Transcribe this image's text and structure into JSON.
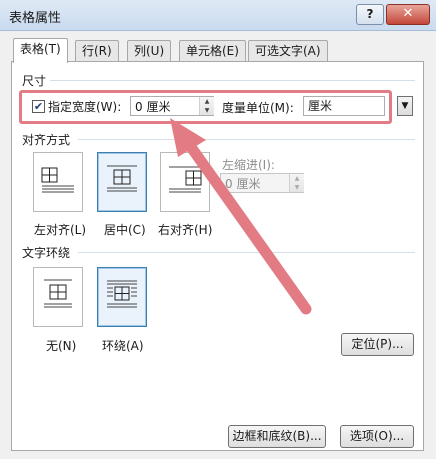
{
  "window": {
    "title": "表格属性",
    "help_label": "?",
    "close_label": "✕"
  },
  "tabs": [
    {
      "label": "表格(T)"
    },
    {
      "label": "行(R)"
    },
    {
      "label": "列(U)"
    },
    {
      "label": "单元格(E)"
    },
    {
      "label": "可选文字(A)"
    }
  ],
  "size": {
    "group_label": "尺寸",
    "checkbox_checked": true,
    "checkbox_label": "指定宽度(W):",
    "width_value": "0 厘米",
    "unit_label": "度量单位(M):",
    "unit_value": "厘米"
  },
  "alignment": {
    "group_label": "对齐方式",
    "options": [
      {
        "label": "左对齐(L)",
        "selected": false
      },
      {
        "label": "居中(C)",
        "selected": true
      },
      {
        "label": "右对齐(H)",
        "selected": false
      }
    ],
    "indent_label": "左缩进(I):",
    "indent_value": "0 厘米"
  },
  "wrapping": {
    "group_label": "文字环绕",
    "options": [
      {
        "label": "无(N)",
        "selected": false
      },
      {
        "label": "环绕(A)",
        "selected": true
      }
    ],
    "position_button": "定位(P)..."
  },
  "footer": {
    "borders_button": "边框和底纹(B)...",
    "options_button": "选项(O)..."
  },
  "colors": {
    "highlight": "#e27b84",
    "arrow": "#e27b84"
  }
}
